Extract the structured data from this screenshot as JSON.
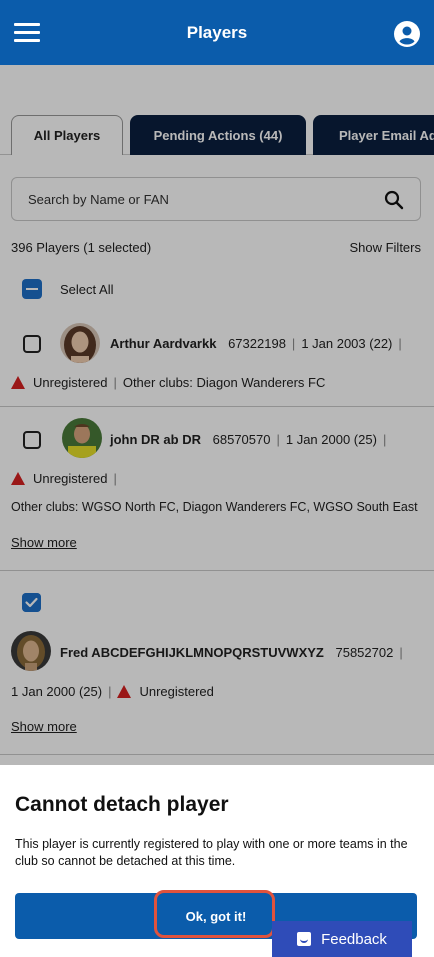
{
  "header": {
    "title": "Players"
  },
  "tabs": [
    {
      "label": "All Players"
    },
    {
      "label": "Pending Actions (44)"
    },
    {
      "label": "Player Email Add"
    }
  ],
  "search": {
    "placeholder": "Search by Name or FAN"
  },
  "summary": {
    "count": "396 Players (1 selected)",
    "show_filters": "Show Filters"
  },
  "select_all": {
    "label": "Select All"
  },
  "players": [
    {
      "name": "Arthur Aardvarkk",
      "fan": "67322198",
      "dob": "1 Jan 2003 (22)",
      "status": "Unregistered",
      "other_clubs": "Other clubs: Diagon Wanderers FC",
      "selected": false
    },
    {
      "name": "john DR ab DR",
      "fan": "68570570",
      "dob": "1 Jan 2000 (25)",
      "status": "Unregistered",
      "other_clubs": "Other clubs: WGSO North FC, Diagon Wanderers FC, WGSO South East",
      "show_more": "Show more",
      "selected": false
    },
    {
      "name": "Fred ABCDEFGHIJKLMNOPQRSTUVWXYZ",
      "fan": "75852702",
      "dob": "1 Jan 2000 (25)",
      "status": "Unregistered",
      "show_more": "Show more",
      "selected": true
    }
  ],
  "dialog": {
    "title": "Cannot detach player",
    "body": "This player is currently registered to play with one or more teams in the club so cannot be detached at this time.",
    "ok_label": "Ok, got it!"
  },
  "feedback": {
    "label": "Feedback"
  },
  "colors": {
    "primary": "#0B5CAB",
    "tab_dark": "#0B1F3F",
    "checkbox": "#1E6FC8",
    "warning": "#D62020",
    "highlight": "#E0533E",
    "feedback": "#2F4CB8"
  }
}
